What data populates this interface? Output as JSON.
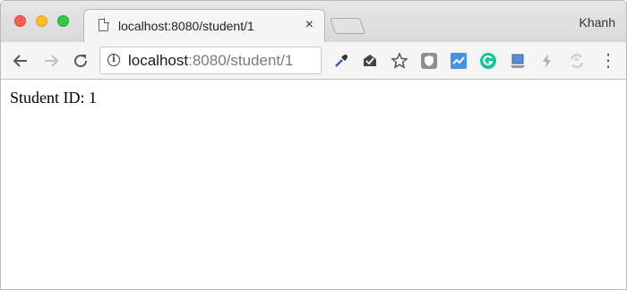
{
  "tab": {
    "title": "localhost:8080/student/1",
    "close_glyph": "×"
  },
  "profile": {
    "name": "Khanh"
  },
  "nav": {
    "back_glyph": "←",
    "forward_glyph": "→",
    "reload_glyph": "↻"
  },
  "omnibox": {
    "host": "localhost",
    "rest": ":8080/student/1"
  },
  "extensions": [
    "eyedropper-icon",
    "mail-check-icon",
    "star-icon",
    "shield-extension-icon",
    "chart-extension-icon",
    "grammarly-icon",
    "laptop-extension-icon",
    "lightning-icon",
    "sync-extension-icon"
  ],
  "menu": {
    "glyph": "⋮"
  },
  "page": {
    "text": "Student ID: 1"
  },
  "colors": {
    "close_red": "#fc5f57",
    "minimize_yellow": "#fdbc2e",
    "zoom_green": "#33c748",
    "grammarly_green": "#15c39a",
    "chart_blue": "#4a90e2"
  }
}
